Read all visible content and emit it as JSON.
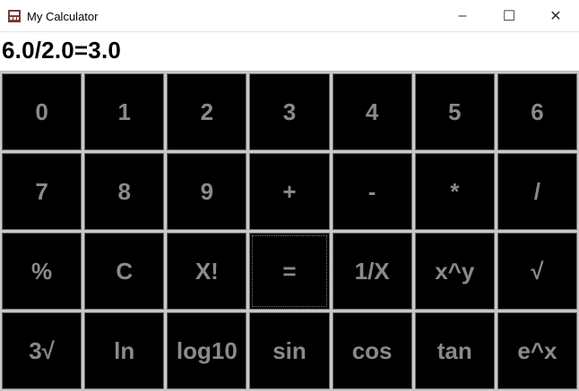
{
  "window": {
    "title": "My Calculator",
    "minimize_glyph": "–",
    "maximize_glyph": "☐",
    "close_glyph": "✕"
  },
  "display": {
    "value": "6.0/2.0=3.0"
  },
  "keys": [
    [
      "0",
      "1",
      "2",
      "3",
      "4",
      "5",
      "6"
    ],
    [
      "7",
      "8",
      "9",
      "+",
      "-",
      "*",
      "/"
    ],
    [
      "%",
      "C",
      "X!",
      "=",
      "1/X",
      "x^y",
      "√"
    ],
    [
      "3√",
      "ln",
      "log10",
      "sin",
      "cos",
      "tan",
      "e^x"
    ]
  ],
  "colors": {
    "key_bg": "#000000",
    "key_text": "#8a8a8a",
    "grid": "#c8c8c8"
  },
  "icons": {
    "app": "calculator-app-icon"
  }
}
